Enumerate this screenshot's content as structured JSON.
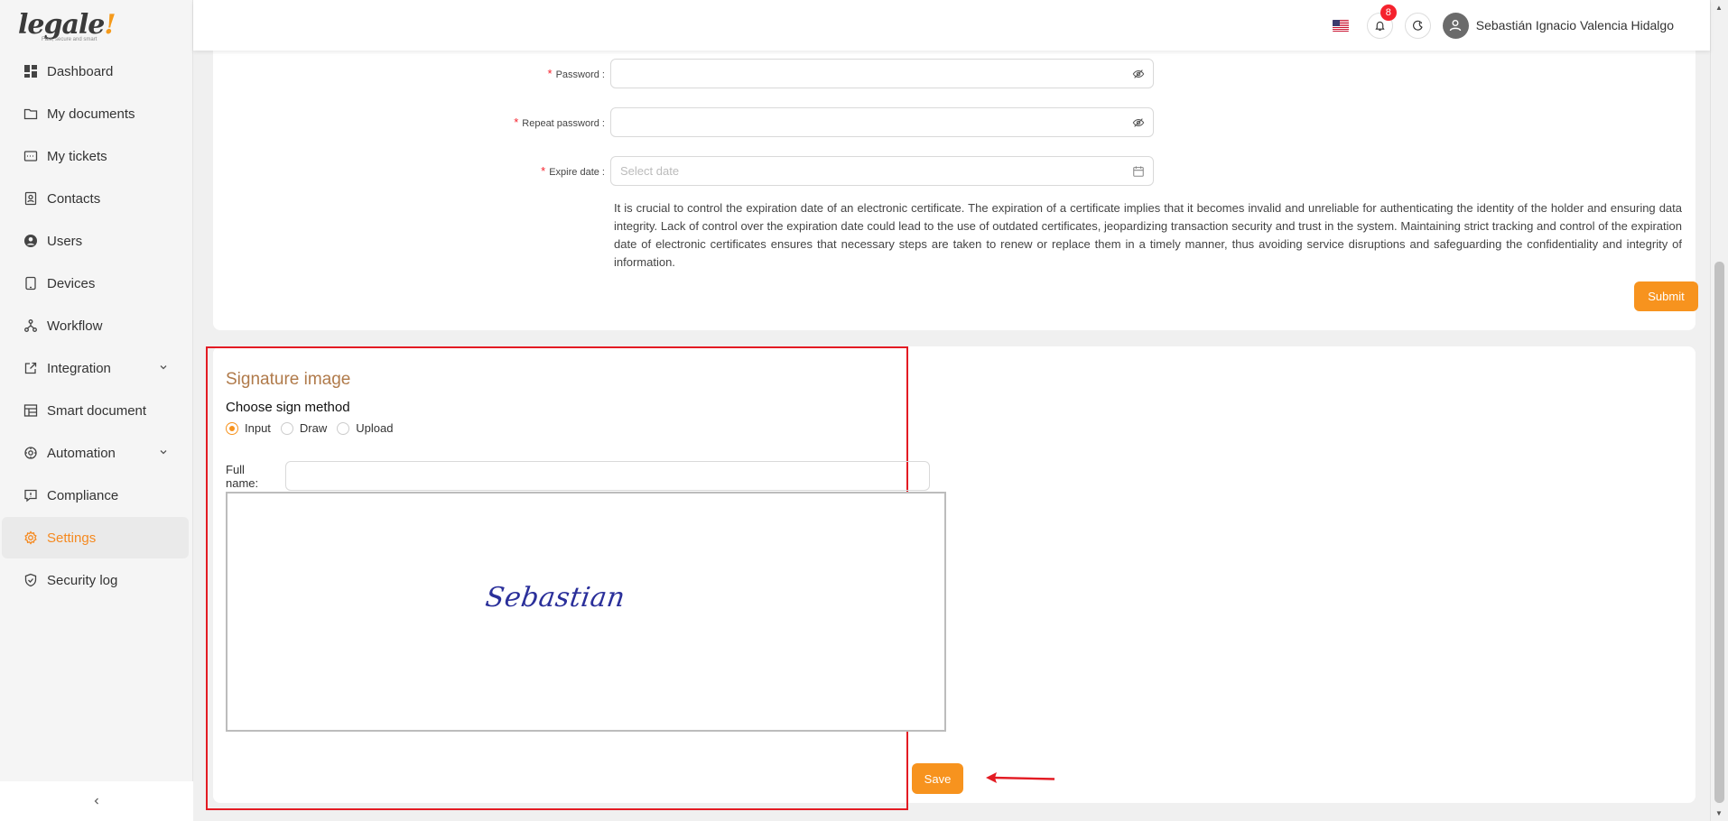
{
  "app": {
    "logo_text": "legale",
    "logo_tagline": "Fast, secure and smart"
  },
  "sidebar": {
    "items": [
      {
        "label": "Dashboard",
        "icon": "dashboard-icon"
      },
      {
        "label": "My documents",
        "icon": "folder-icon"
      },
      {
        "label": "My tickets",
        "icon": "ticket-icon"
      },
      {
        "label": "Contacts",
        "icon": "contacts-icon"
      },
      {
        "label": "Users",
        "icon": "user-circle-icon"
      },
      {
        "label": "Devices",
        "icon": "tablet-icon"
      },
      {
        "label": "Workflow",
        "icon": "workflow-icon"
      },
      {
        "label": "Integration",
        "icon": "external-link-icon",
        "expandable": true
      },
      {
        "label": "Smart document",
        "icon": "layout-icon"
      },
      {
        "label": "Automation",
        "icon": "automation-icon",
        "expandable": true
      },
      {
        "label": "Compliance",
        "icon": "comment-icon"
      },
      {
        "label": "Settings",
        "icon": "gear-icon",
        "active": true
      },
      {
        "label": "Security log",
        "icon": "shield-icon"
      }
    ]
  },
  "header": {
    "notification_count": "8",
    "user_name": "Sebastián Ignacio Valencia Hidalgo",
    "language": "en-US"
  },
  "certificate_form": {
    "password_label": "Password",
    "repeat_password_label": "Repeat password",
    "expire_date_label": "Expire date",
    "expire_date_placeholder": "Select date",
    "help_text": "It is crucial to control the expiration date of an electronic certificate. The expiration of a certificate implies that it becomes invalid and unreliable for authenticating the identity of the holder and ensuring data integrity. Lack of control over the expiration date could lead to the use of outdated certificates, jeopardizing transaction security and trust in the system. Maintaining strict tracking and control of the expiration date of electronic certificates ensures that necessary steps are taken to renew or replace them in a timely manner, thus avoiding service disruptions and safeguarding the confidentiality and integrity of information.",
    "submit_label": "Submit"
  },
  "signature": {
    "title": "Signature image",
    "method_label": "Choose sign method",
    "methods": [
      "Input",
      "Draw",
      "Upload"
    ],
    "selected_method": "Input",
    "full_name_label": "Full name:",
    "full_name_value": "",
    "preview_text": "Sebastian",
    "save_label": "Save"
  },
  "colors": {
    "accent": "#f7931e",
    "highlight": "#e31b23",
    "signature_ink": "#2a2f9a",
    "title": "#b07a4a"
  }
}
